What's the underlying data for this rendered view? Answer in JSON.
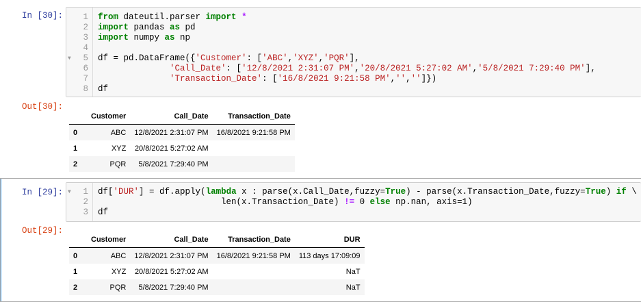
{
  "cells": [
    {
      "in_prompt": "In [30]:",
      "out_prompt": "Out[30]:",
      "code": [
        {
          "num": "1",
          "fold": false,
          "tokens": [
            [
              "kw",
              "from"
            ],
            [
              "nm",
              " dateutil.parser "
            ],
            [
              "kw",
              "import"
            ],
            [
              "nm",
              " "
            ],
            [
              "op",
              "*"
            ]
          ]
        },
        {
          "num": "2",
          "fold": false,
          "tokens": [
            [
              "kw",
              "import"
            ],
            [
              "nm",
              " pandas "
            ],
            [
              "kw",
              "as"
            ],
            [
              "nm",
              " pd"
            ]
          ]
        },
        {
          "num": "3",
          "fold": false,
          "tokens": [
            [
              "kw",
              "import"
            ],
            [
              "nm",
              " numpy "
            ],
            [
              "kw",
              "as"
            ],
            [
              "nm",
              " np"
            ]
          ]
        },
        {
          "num": "4",
          "fold": false,
          "tokens": []
        },
        {
          "num": "5",
          "fold": true,
          "tokens": [
            [
              "nm",
              "df = pd.DataFrame({"
            ],
            [
              "str",
              "'Customer'"
            ],
            [
              "nm",
              ": ["
            ],
            [
              "str",
              "'ABC'"
            ],
            [
              "nm",
              ","
            ],
            [
              "str",
              "'XYZ'"
            ],
            [
              "nm",
              ","
            ],
            [
              "str",
              "'PQR'"
            ],
            [
              "nm",
              "],"
            ]
          ]
        },
        {
          "num": "6",
          "fold": false,
          "tokens": [
            [
              "nm",
              "              "
            ],
            [
              "str",
              "'Call_Date'"
            ],
            [
              "nm",
              ": ["
            ],
            [
              "str",
              "'12/8/2021 2:31:07 PM'"
            ],
            [
              "nm",
              ","
            ],
            [
              "str",
              "'20/8/2021 5:27:02 AM'"
            ],
            [
              "nm",
              ","
            ],
            [
              "str",
              "'5/8/2021 7:29:40 PM'"
            ],
            [
              "nm",
              "],"
            ]
          ]
        },
        {
          "num": "7",
          "fold": false,
          "tokens": [
            [
              "nm",
              "              "
            ],
            [
              "str",
              "'Transaction_Date'"
            ],
            [
              "nm",
              ": ["
            ],
            [
              "str",
              "'16/8/2021 9:21:58 PM'"
            ],
            [
              "nm",
              ","
            ],
            [
              "str",
              "''"
            ],
            [
              "nm",
              ","
            ],
            [
              "str",
              "''"
            ],
            [
              "nm",
              "]})"
            ]
          ]
        },
        {
          "num": "8",
          "fold": false,
          "tokens": [
            [
              "nm",
              "df"
            ]
          ]
        }
      ],
      "table": {
        "columns": [
          "",
          "Customer",
          "Call_Date",
          "Transaction_Date"
        ],
        "rows": [
          [
            "0",
            "ABC",
            "12/8/2021 2:31:07 PM",
            "16/8/2021 9:21:58 PM"
          ],
          [
            "1",
            "XYZ",
            "20/8/2021 5:27:02 AM",
            ""
          ],
          [
            "2",
            "PQR",
            "5/8/2021 7:29:40 PM",
            ""
          ]
        ]
      }
    },
    {
      "in_prompt": "In [29]:",
      "out_prompt": "Out[29]:",
      "code": [
        {
          "num": "1",
          "fold": true,
          "tokens": [
            [
              "nm",
              "df["
            ],
            [
              "str",
              "'DUR'"
            ],
            [
              "nm",
              "] = df.apply("
            ],
            [
              "kw",
              "lambda"
            ],
            [
              "nm",
              " x : parse(x.Call_Date,fuzzy="
            ],
            [
              "kw",
              "True"
            ],
            [
              "nm",
              ") - parse(x.Transaction_Date,fuzzy="
            ],
            [
              "kw",
              "True"
            ],
            [
              "nm",
              ") "
            ],
            [
              "kw",
              "if"
            ],
            [
              "nm",
              " \\"
            ]
          ]
        },
        {
          "num": "2",
          "fold": false,
          "tokens": [
            [
              "nm",
              "                        len(x.Transaction_Date) "
            ],
            [
              "op",
              "!="
            ],
            [
              "nm",
              " 0 "
            ],
            [
              "kw",
              "else"
            ],
            [
              "nm",
              " np.nan, axis=1)"
            ]
          ]
        },
        {
          "num": "3",
          "fold": false,
          "tokens": [
            [
              "nm",
              "df"
            ]
          ]
        }
      ],
      "table": {
        "columns": [
          "",
          "Customer",
          "Call_Date",
          "Transaction_Date",
          "DUR"
        ],
        "rows": [
          [
            "0",
            "ABC",
            "12/8/2021 2:31:07 PM",
            "16/8/2021 9:21:58 PM",
            "113 days 17:09:09"
          ],
          [
            "1",
            "XYZ",
            "20/8/2021 5:27:02 AM",
            "",
            "NaT"
          ],
          [
            "2",
            "PQR",
            "5/8/2021 7:29:40 PM",
            "",
            "NaT"
          ]
        ]
      }
    }
  ]
}
